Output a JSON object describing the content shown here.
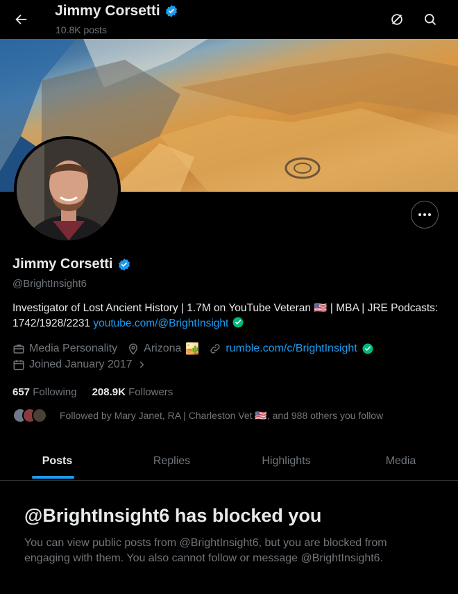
{
  "header": {
    "name": "Jimmy Corsetti",
    "posts_count": "10.8K posts"
  },
  "profile": {
    "name": "Jimmy Corsetti",
    "handle": "@BrightInsight6",
    "bio_text": "Investigator of Lost Ancient History | 1.7M on YouTube Veteran 🇺🇸 | MBA | JRE Podcasts: 1742/1928/2231",
    "bio_link": "youtube.com/@BrightInsight",
    "category": "Media Personality",
    "location": "Arizona",
    "location_emoji": "🏜️",
    "website": "rumble.com/c/BrightInsight",
    "joined": "Joined January 2017"
  },
  "counts": {
    "following_value": "657",
    "following_label": "Following",
    "followers_value": "208.9K",
    "followers_label": "Followers"
  },
  "followed_by": "Followed by Mary Janet, RA | Charleston Vet 🇺🇸, and 988 others you follow",
  "tabs": [
    "Posts",
    "Replies",
    "Highlights",
    "Media"
  ],
  "blocked": {
    "title": "@BrightInsight6 has blocked you",
    "text": "You can view public posts from @BrightInsight6, but you are blocked from engaging with them. You also cannot follow or message @BrightInsight6."
  },
  "colors": {
    "accent": "#1d9bf0",
    "verified": "#1d9bf0",
    "link_check": "#00ba7c",
    "muted": "#71767b",
    "background": "#000000"
  }
}
